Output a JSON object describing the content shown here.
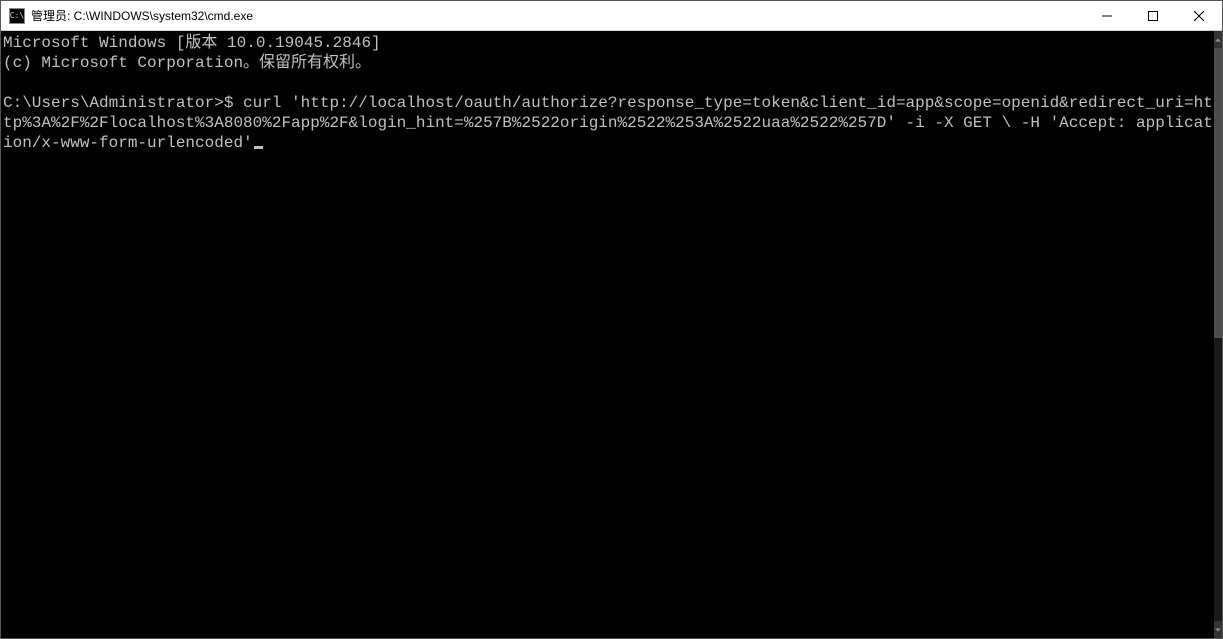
{
  "window": {
    "title": "管理员: C:\\WINDOWS\\system32\\cmd.exe"
  },
  "terminal": {
    "banner_line1": "Microsoft Windows [版本 10.0.19045.2846]",
    "banner_line2": "(c) Microsoft Corporation。保留所有权利。",
    "prompt": "C:\\Users\\Administrator>$ ",
    "command": "curl 'http://localhost/oauth/authorize?response_type=token&client_id=app&scope=openid&redirect_uri=http%3A%2F%2Flocalhost%3A8080%2Fapp%2F&login_hint=%257B%2522origin%2522%253A%2522uaa%2522%257D' -i -X GET \\ -H 'Accept: application/x-www-form-urlencoded'"
  }
}
